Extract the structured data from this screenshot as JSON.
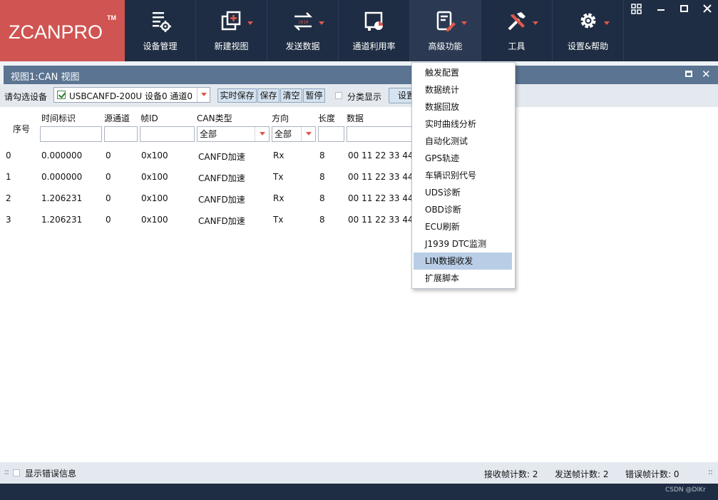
{
  "app": {
    "logo": "ZCANPRO",
    "logo_tm": "TM"
  },
  "ribbon": {
    "tools": [
      {
        "label": "设备管理",
        "icon": "device-manage-icon"
      },
      {
        "label": "新建视图",
        "icon": "new-view-icon"
      },
      {
        "label": "发送数据",
        "icon": "send-data-icon"
      },
      {
        "label": "通道利用率",
        "icon": "channel-usage-icon"
      },
      {
        "label": "高级功能",
        "icon": "advanced-function-icon"
      },
      {
        "label": "工具",
        "icon": "tools-icon"
      },
      {
        "label": "设置&帮助",
        "icon": "settings-gear-icon"
      }
    ]
  },
  "view": {
    "title": "视图1:CAN 视图",
    "device_label": "请勾选设备",
    "device_value": "USBCANFD-200U 设备0 通道0",
    "buttons": [
      "实时保存",
      "保存",
      "清空",
      "暂停"
    ],
    "classify_label": "分类显示",
    "settings_label": "设置"
  },
  "table": {
    "columns": [
      "序号",
      "时间标识",
      "源通道",
      "帧ID",
      "CAN类型",
      "方向",
      "长度",
      "数据"
    ],
    "filters": {
      "can_type": "全部",
      "direction": "全部"
    },
    "rows": [
      [
        "0",
        "0.000000",
        "0",
        "0x100",
        "CANFD加速",
        "Rx",
        "8",
        "00 11 22 33 44"
      ],
      [
        "1",
        "0.000000",
        "0",
        "0x100",
        "CANFD加速",
        "Tx",
        "8",
        "00 11 22 33 44"
      ],
      [
        "2",
        "1.206231",
        "0",
        "0x100",
        "CANFD加速",
        "Rx",
        "8",
        "00 11 22 33 44"
      ],
      [
        "3",
        "1.206231",
        "0",
        "0x100",
        "CANFD加速",
        "Tx",
        "8",
        "00 11 22 33 44"
      ]
    ]
  },
  "advanced_menu": {
    "items": [
      "触发配置",
      "数据统计",
      "数据回放",
      "实时曲线分析",
      "自动化测试",
      "GPS轨迹",
      "车辆识别代号",
      "UDS诊断",
      "OBD诊断",
      "ECU刷新",
      "J1939 DTC监测",
      "LIN数据收发",
      "扩展脚本"
    ],
    "highlighted": "LIN数据收发"
  },
  "statusbar": {
    "show_errors_label": "显示错误信息",
    "rx_count": "接收帧计数: 2",
    "tx_count": "发送帧计数: 2",
    "err_count": "错误帧计数: 0"
  },
  "watermark": "CSDN @DIKr",
  "colors": {
    "ribbon_bg": "#1e2d43",
    "logo_bg": "#d05451",
    "accent_caret": "#e0584d",
    "view_title_bg": "#5a7491",
    "menu_highlight": "#b9cde6"
  }
}
